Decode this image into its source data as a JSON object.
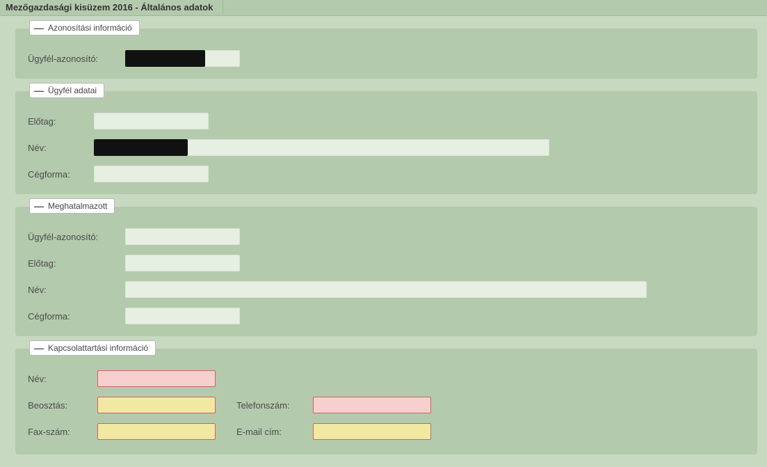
{
  "tab": {
    "title": "Mezőgazdasági kisüzem 2016 - Általános adatok"
  },
  "section_id": {
    "legend": "Azonosítási információ",
    "client_id_label": "Ügyfél-azonosító:"
  },
  "section_client": {
    "legend": "Ügyfél adatai",
    "prefix_label": "Előtag:",
    "name_label": "Név:",
    "company_form_label": "Cégforma:"
  },
  "section_proxy": {
    "legend": "Meghatalmazott",
    "client_id_label": "Ügyfél-azonosító:",
    "prefix_label": "Előtag:",
    "name_label": "Név:",
    "company_form_label": "Cégforma:"
  },
  "section_contact": {
    "legend": "Kapcsolattartási információ",
    "name_label": "Név:",
    "position_label": "Beosztás:",
    "phone_label": "Telefonszám:",
    "fax_label": "Fax-szám:",
    "email_label": "E-mail cím:"
  }
}
